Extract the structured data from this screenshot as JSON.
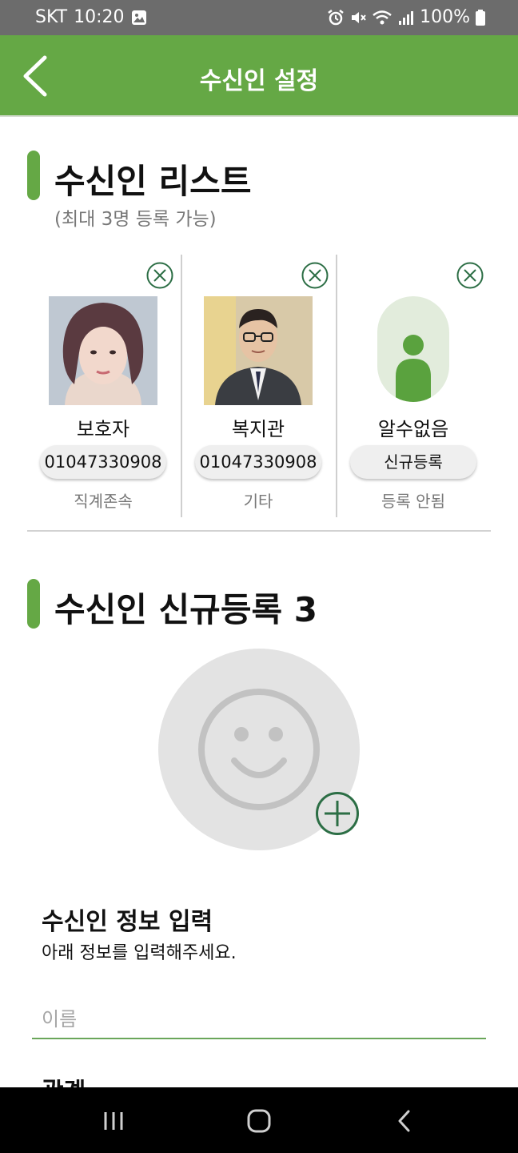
{
  "status_bar": {
    "carrier": "SKT",
    "time": "10:20",
    "battery": "100%"
  },
  "header": {
    "title": "수신인 설정"
  },
  "recipient_list": {
    "title": "수신인 리스트",
    "subtitle": "(최대 3명 등록 가능)",
    "cards": [
      {
        "name": "보호자",
        "phone": "01047330908",
        "relation": "직계존속"
      },
      {
        "name": "복지관",
        "phone": "01047330908",
        "relation": "기타"
      },
      {
        "name": "알수없음",
        "action_label": "신규등록",
        "relation": "등록 안됨"
      }
    ]
  },
  "new_registration": {
    "title": "수신인 신규등록 3",
    "info_title": "수신인 정보 입력",
    "info_subtitle": "아래 정보를 입력해주세요.",
    "name_placeholder": "이름",
    "next_label": "관계"
  },
  "colors": {
    "accent": "#65a845",
    "status_bar": "#6c6c6c",
    "nav_bar": "#000000"
  }
}
